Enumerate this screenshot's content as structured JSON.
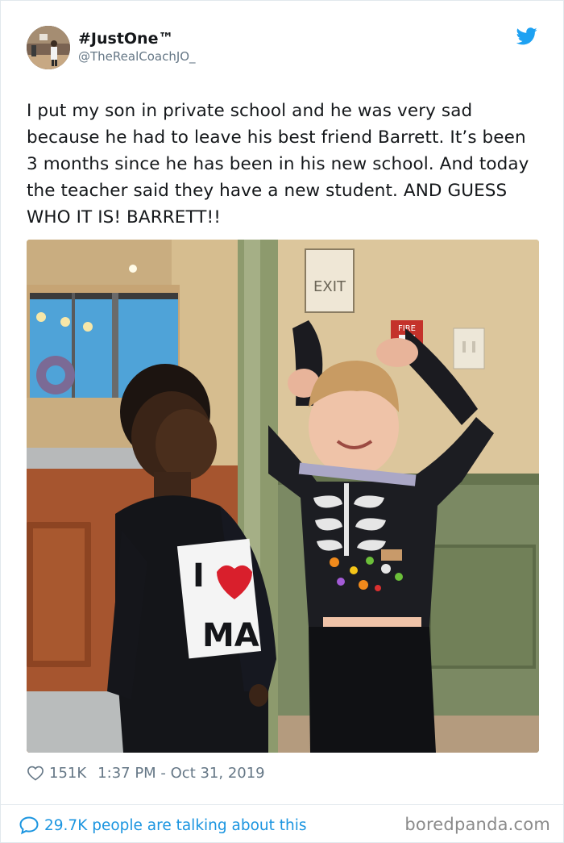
{
  "user": {
    "display_name": "#JustOne™",
    "handle": "@TheRealCoachJO_"
  },
  "tweet": {
    "text": "I put my son in private school and he was very sad because he had to leave his best friend Barrett. It’s been 3 months since he has been in his new school. And today the teacher said they have a new student. AND GUESS WHO IT IS! BARRETT!!",
    "photo_signs": {
      "exit": "EXIT",
      "fire": "FIRE",
      "shirt_top": "I",
      "shirt_bottom": "MA"
    },
    "likes": "151K",
    "timestamp": "1:37 PM - Oct 31, 2019"
  },
  "footer": {
    "talk_label": "29.7K people are talking about this",
    "watermark": "boredpanda.com"
  },
  "icons": {
    "brand": "twitter-bird-icon",
    "like": "heart-icon",
    "talk": "speech-bubble-icon"
  },
  "colors": {
    "twitter_blue": "#1da1f2",
    "link_blue": "#1b95e0",
    "muted_text": "#657786",
    "primary_text": "#14171a"
  }
}
